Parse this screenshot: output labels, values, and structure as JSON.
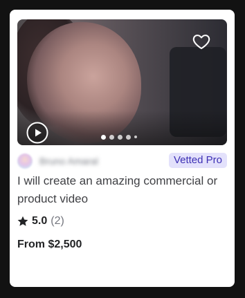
{
  "gig": {
    "media": {
      "slide_count": 5,
      "active_slide": 1,
      "icons": {
        "favorite": "heart-outline-icon",
        "play": "play-circle-icon"
      }
    },
    "seller": {
      "name": "Bruno Amaral",
      "badge": "Vetted Pro"
    },
    "title": "I will create an amazing commercial or product video",
    "rating": {
      "icon": "star-icon",
      "value": "5.0",
      "count": "(2)"
    },
    "price": "From $2,500"
  },
  "colors": {
    "badge_bg": "#e3e1fb",
    "badge_text": "#3c2fb4",
    "title_text": "#404145",
    "strong_text": "#222325"
  }
}
